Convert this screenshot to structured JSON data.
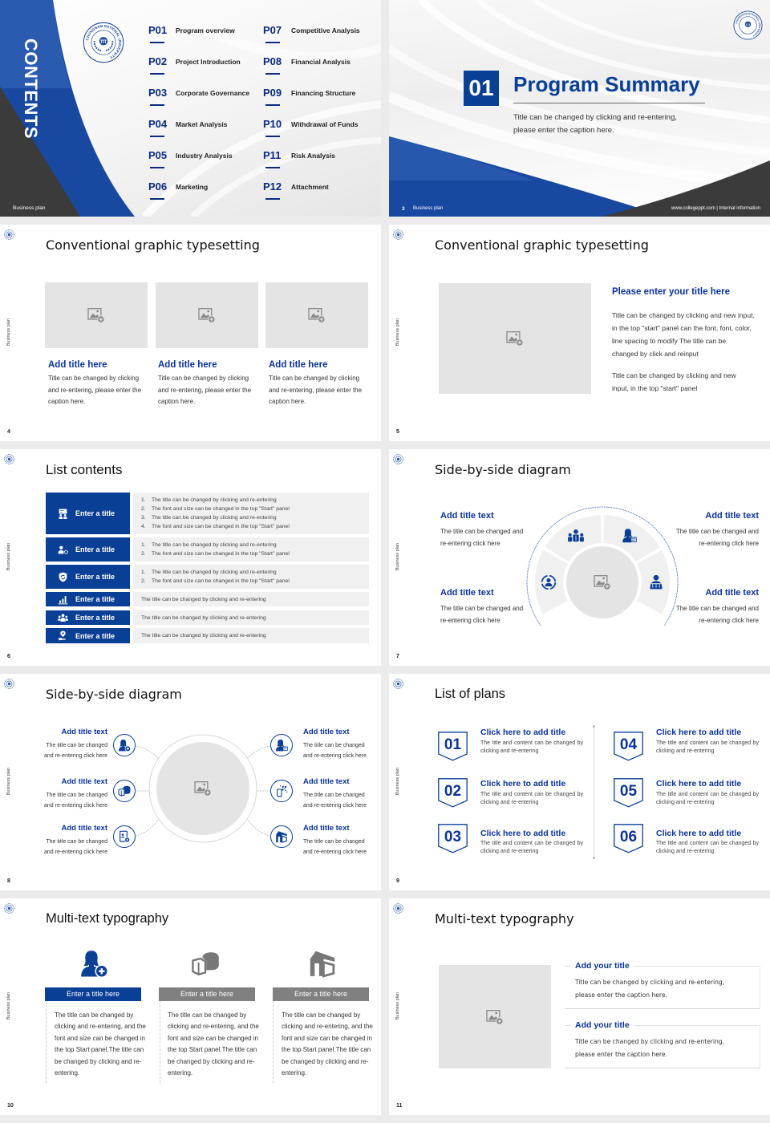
{
  "colors": {
    "brand_blue": "#0a3f96",
    "navy": "#0b2b7e",
    "title_blue": "#0a3399",
    "dark_gray": "#3b3b3b",
    "placeholder_gray": "#e4e4e4",
    "header_gray": "#808080",
    "list_bg": "#f0f0f0",
    "canvas_bg": "#ebebeb"
  },
  "common": {
    "side_label": "Business plan",
    "logo_ring_text": "CHUNGNAM NATIONAL UNIVERSITY",
    "logo_icon": "university-seal-icon",
    "placeholder_icon": "image-add-icon"
  },
  "contents": {
    "heading": "CONTENTS",
    "footer": "Business plan",
    "items": [
      {
        "code": "P01",
        "label": "Program overview"
      },
      {
        "code": "P02",
        "label": "Project Introduction"
      },
      {
        "code": "P03",
        "label": "Corporate Governance"
      },
      {
        "code": "P04",
        "label": "Market Analysis"
      },
      {
        "code": "P05",
        "label": "Industry Analysis"
      },
      {
        "code": "P06",
        "label": "Marketing"
      },
      {
        "code": "P07",
        "label": "Competitive Analysis"
      },
      {
        "code": "P08",
        "label": "Financial Analysis"
      },
      {
        "code": "P09",
        "label": "Financing Structure"
      },
      {
        "code": "P10",
        "label": "Withdrawal of Funds"
      },
      {
        "code": "P11",
        "label": "Risk Analysis"
      },
      {
        "code": "P12",
        "label": "Attachment"
      }
    ]
  },
  "section": {
    "number": "01",
    "title": "Program Summary",
    "caption_lines": [
      "Title can be changed by clicking and re-entering,",
      "please enter the caption here."
    ],
    "page": "3",
    "footer_left": "Business plan",
    "footer_right": "www.collegeppt.com | Internal information"
  },
  "graphic_a": {
    "page": "4",
    "title": "Conventional graphic typesetting",
    "cards": [
      {
        "title": "Add title here",
        "text": "Title can be changed by clicking and re-entering, please enter the caption here."
      },
      {
        "title": "Add title here",
        "text": "Title can be changed by clicking and re-entering, please enter the caption here."
      },
      {
        "title": "Add title here",
        "text": "Title can be changed by clicking and re-entering, please enter the caption here."
      }
    ]
  },
  "graphic_b": {
    "page": "5",
    "title": "Conventional graphic typesetting",
    "heading": "Please enter your title here",
    "paragraph1_lines": [
      "Title can be changed by clicking and new input,",
      "in the top \"start\" panel can the font, font, color,",
      "line spacing to modify The title can be",
      "changed by click and reinput"
    ],
    "paragraph2_lines": [
      "Title can be changed by clicking and new",
      "input, in the top \"start\" panel"
    ]
  },
  "list": {
    "page": "6",
    "title": "List contents",
    "rows": [
      {
        "icon": "presentation-icon",
        "label": "Enter a title",
        "items": [
          "The title can be changed by clicking and re-entering",
          "The font and size can be changed in the top \"Start\" panel",
          "The title can be changed by clicking and re-entering",
          "The font and size can be changed in the top \"Start\" panel"
        ]
      },
      {
        "icon": "user-gear-icon",
        "label": "Enter a title",
        "items": [
          "The title can be changed by clicking and re-entering",
          "The font and size can be changed in the top \"Start\" panel"
        ]
      },
      {
        "icon": "shield-icon",
        "label": "Enter a title",
        "items": [
          "The title can be changed by clicking and re-entering",
          "The font and size can be changed in the top \"Start\" panel"
        ]
      },
      {
        "icon": "bar-chart-icon",
        "label": "Enter a title",
        "text": "The title can be changed by clicking and re-entering"
      },
      {
        "icon": "team-icon",
        "label": "Enter a title",
        "text": "The title can be changed by clicking and re-entering"
      },
      {
        "icon": "location-hand-icon",
        "label": "Enter a title",
        "text": "The title can be changed by clicking and re-entering"
      }
    ],
    "numbers": [
      "1.",
      "2.",
      "3.",
      "4."
    ]
  },
  "arc_diagram": {
    "page": "7",
    "title": "Side-by-side diagram",
    "blocks": [
      {
        "title": "Add title text",
        "text": "The title can be changed and re-entering click here"
      },
      {
        "title": "Add title text",
        "text": "The title can be changed and re-entering click here"
      },
      {
        "title": "Add title text",
        "text": "The title can be changed and re-entering click here"
      },
      {
        "title": "Add title text",
        "text": "The title can be changed and re-entering click here"
      }
    ],
    "segment_icons": [
      "user-cycle-icon",
      "group-icon",
      "female-edit-icon",
      "reader-icon"
    ]
  },
  "hub_diagram": {
    "page": "8",
    "title": "Side-by-side diagram",
    "left": [
      {
        "icon": "female-add-icon",
        "title": "Add title text",
        "text": "The title can be changed and re-entering click here"
      },
      {
        "icon": "pie-3d-icon",
        "title": "Add title text",
        "text": "The title can be changed and re-entering click here"
      },
      {
        "icon": "id-card-icon",
        "title": "Add title text",
        "text": "The title can be changed and re-entering click here"
      }
    ],
    "right": [
      {
        "icon": "female-card-icon",
        "title": "Add title text",
        "text": "The title can be changed and re-entering click here"
      },
      {
        "icon": "phone-scan-icon",
        "title": "Add title text",
        "text": "The title can be changed and re-entering click here"
      },
      {
        "icon": "building-icon",
        "title": "Add title text",
        "text": "The title can be changed and re-entering click here"
      }
    ]
  },
  "plans": {
    "page": "9",
    "title": "List of plans",
    "items": [
      {
        "number": "01",
        "title": "Click here to add title",
        "text": "The title and content can be changed by clicking and re-entering"
      },
      {
        "number": "02",
        "title": "Click here to add title",
        "text": "The title and content can be changed by clicking and re-entering"
      },
      {
        "number": "03",
        "title": "Click here to add title",
        "text": "The title and content can be changed by clicking and re-entering"
      },
      {
        "number": "04",
        "title": "Click here to add title",
        "text": "The title and content can be changed by clicking and re-entering"
      },
      {
        "number": "05",
        "title": "Click here to add title",
        "text": "The title and content can be changed by clicking and re-entering"
      },
      {
        "number": "06",
        "title": "Click here to add title",
        "text": "The title and content can be changed by clicking and re-entering"
      }
    ]
  },
  "multi_a": {
    "page": "10",
    "title": "Multi-text typography",
    "columns": [
      {
        "icon": "female-add-icon",
        "header": "Enter a title here",
        "text": "The title can be changed by clicking and re-entering, and the font and size can be changed in the top Start panel.The title can be changed by clicking and re-entering."
      },
      {
        "icon": "pie-3d-icon",
        "header": "Enter a title here",
        "text": "The title can be changed by clicking and re-entering, and the font and size can be changed in the top Start panel.The title can be changed by clicking and re-entering."
      },
      {
        "icon": "building-icon",
        "header": "Enter a title here",
        "text": "The title can be changed by clicking and re-entering, and the font and size can be changed in the top Start panel.The title can be changed by clicking and re-entering."
      }
    ]
  },
  "multi_b": {
    "page": "11",
    "title": "Multi-text typography",
    "blocks": [
      {
        "title": "Add your title",
        "lines": [
          "Title can be changed by clicking and re-entering,",
          "please enter the caption here."
        ]
      },
      {
        "title": "Add your title",
        "lines": [
          "Title can be changed by clicking and re-entering,",
          "please enter the caption here."
        ]
      }
    ]
  }
}
